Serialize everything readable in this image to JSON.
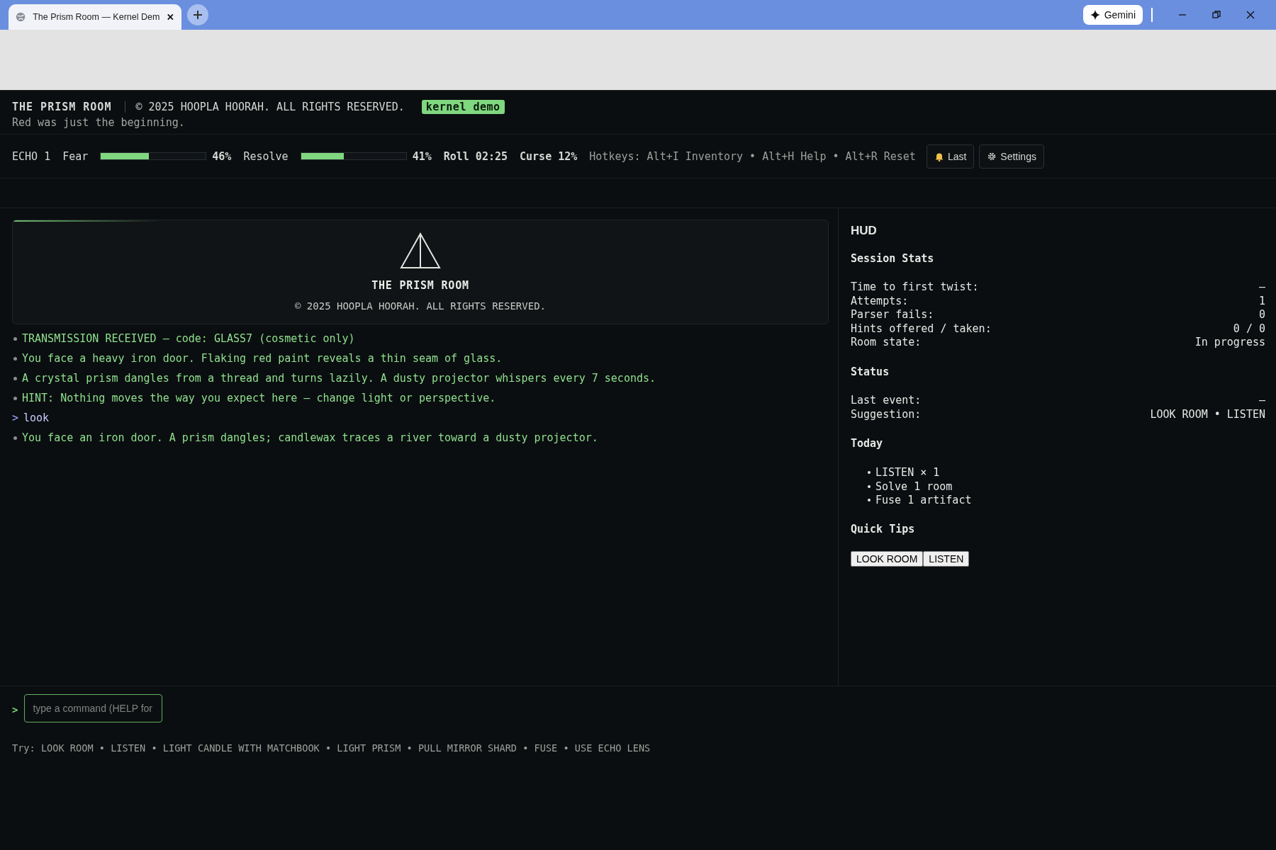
{
  "browser": {
    "tab_title": "The Prism Room — Kernel Dem",
    "gemini_label": "Gemini"
  },
  "header": {
    "title": "THE PRISM ROOM",
    "copyright": "© 2025 HOOPLA HOORAH. ALL RIGHTS RESERVED.",
    "badge": "kernel demo",
    "tagline": "Red was just the beginning."
  },
  "stats": {
    "echo": "ECHO 1",
    "meters": [
      {
        "label": "Fear",
        "level": 0.46,
        "reading": "46%"
      },
      {
        "label": "Resolve",
        "level": 0.41,
        "reading": "41%"
      }
    ],
    "roll": "Roll 02:25",
    "curse": "Curse 12%",
    "hotkeys": "Hotkeys: Alt+I Inventory • Alt+H Help • Alt+R Reset",
    "buttons": [
      {
        "label": "Last",
        "kind": "bell"
      },
      {
        "label": "Settings",
        "kind": "gear"
      }
    ]
  },
  "splash": {
    "title": "THE PRISM ROOM",
    "copyright": "© 2025 HOOPLA HOORAH. ALL RIGHTS RESERVED."
  },
  "log": [
    {
      "kind": "message",
      "text": "TRANSMISSION RECEIVED — code: GLASS7 (cosmetic only)"
    },
    {
      "kind": "message",
      "text": "You face a heavy iron door. Flaking red paint reveals a thin seam of glass."
    },
    {
      "kind": "message",
      "text": "A crystal prism dangles from a thread and turns lazily. A dusty projector whispers every 7 seconds."
    },
    {
      "kind": "message",
      "text": "HINT: Nothing moves the way you expect here — change light or perspective."
    },
    {
      "kind": "command",
      "prompt": ">",
      "text": "look"
    },
    {
      "kind": "message",
      "text": "You face an iron door. A prism dangles; candlewax traces a river toward a dusty projector."
    }
  ],
  "hud": {
    "title": "HUD",
    "sections": [
      {
        "kind": "pairs",
        "heading": "Session Stats",
        "rows": [
          {
            "label": "Time to first twist:",
            "value": "—"
          },
          {
            "label": "Attempts:",
            "value": "1"
          },
          {
            "label": "Parser fails:",
            "value": "0"
          },
          {
            "label": "Hints offered / taken:",
            "value": "0 / 0"
          },
          {
            "label": "Room state:",
            "value": "In progress"
          }
        ]
      },
      {
        "kind": "pairs",
        "heading": "Status",
        "rows": [
          {
            "label": "Last event:",
            "value": "—"
          },
          {
            "label": "Suggestion:",
            "value": "LOOK ROOM • LISTEN"
          }
        ]
      },
      {
        "kind": "list",
        "heading": "Today",
        "items": [
          "LISTEN × 1",
          "Solve 1 room",
          "Fuse 1 artifact"
        ]
      },
      {
        "kind": "buttons",
        "heading": "Quick Tips",
        "buttons": [
          "LOOK ROOM",
          "LISTEN"
        ]
      }
    ]
  },
  "command": {
    "prompt": ">",
    "placeholder": "type a command (HELP for"
  },
  "try_line": "Try: LOOK ROOM • LISTEN • LIGHT CANDLE WITH MATCHBOOK • LIGHT PRISM • PULL MIRROR SHARD • FUSE • USE ECHO LENS"
}
